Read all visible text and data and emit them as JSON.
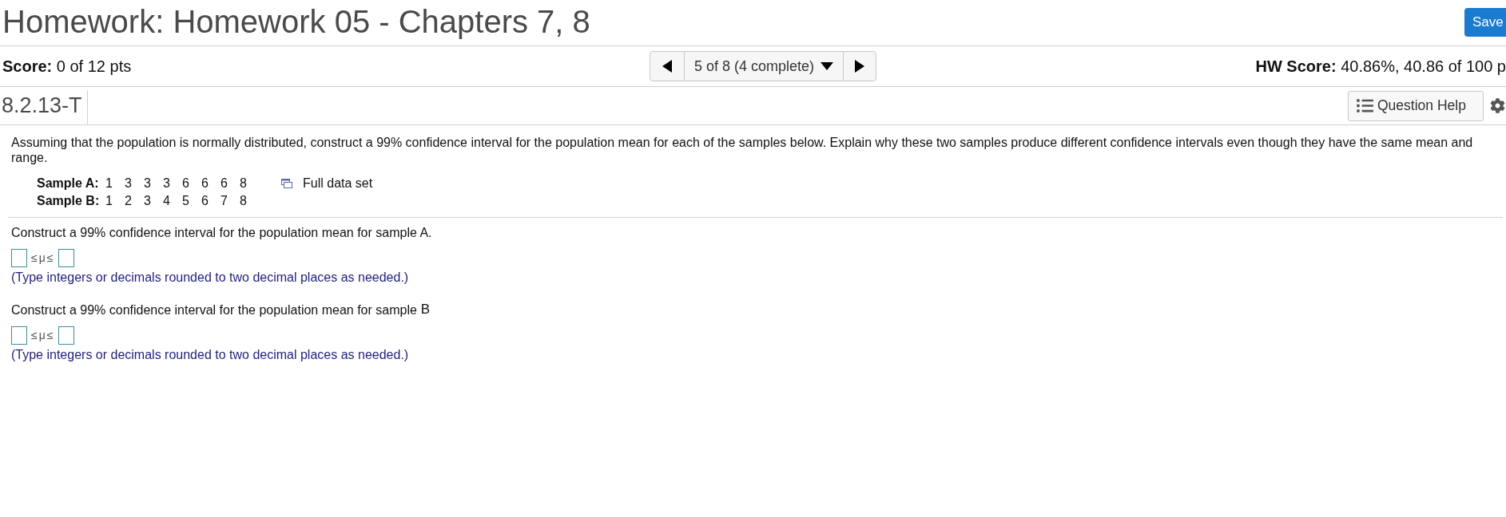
{
  "header": {
    "title": "Homework: Homework 05 - Chapters 7, 8",
    "save_button": "Save"
  },
  "score_bar": {
    "score": "**Score:** 0 of 12 pts",
    "navigator": {
      "position": "5 of 8 (4 complete)"
    },
    "hw_score": "**HW Score:** 40.86%, 40.86 of 100 p"
  },
  "question_bar": {
    "question_id": "8.2.13-T",
    "help_button": "Question Help"
  },
  "question": {
    "text": "Assuming that the population is normally distributed, construct a 99% confidence interval for the population mean for each of the samples below. Explain why these two samples produce different confidence intervals even though they have the same mean and range.",
    "samples": [
      {
        "label": "Sample A:",
        "values": [
          "1",
          "3",
          "3",
          "3",
          "6",
          "6",
          "6",
          "8"
        ]
      },
      {
        "label": "Sample B:",
        "values": [
          "1",
          "2",
          "3",
          "4",
          "5",
          "6",
          "7",
          "8"
        ]
      }
    ],
    "data_link": "Full data set"
  },
  "parts": [
    {
      "prompt": "Construct a 99% confidence interval for the population mean for sample A.",
      "relation": "≤μ≤",
      "hint": "(Type integers or decimals rounded to two decimal places as needed.)"
    },
    {
      "prompt": "Construct a 99% confidence interval for the population mean for sample",
      "variable": "B",
      "relation": "≤μ≤",
      "hint": "(Type integers or decimals rounded to two decimal places as needed.)"
    }
  ]
}
